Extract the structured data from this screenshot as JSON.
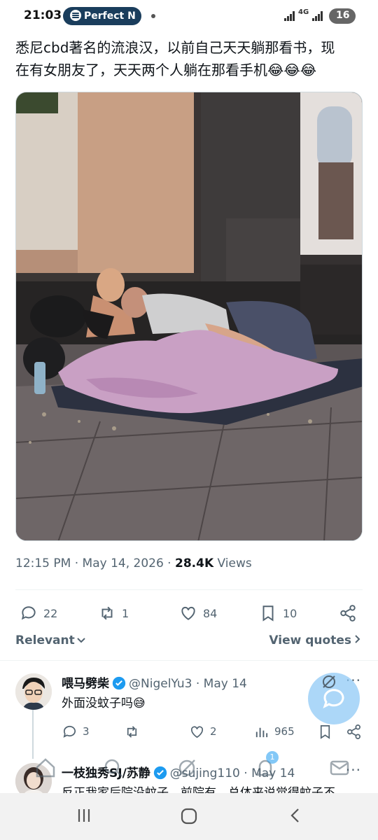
{
  "status_bar": {
    "time": "21:03",
    "app_pill": "Perfect N",
    "network": "4G",
    "battery": "16"
  },
  "tweet": {
    "text_line1": "悉尼cbd著名的流浪汉，以前自己天天躺那看书，现",
    "text_line2": "在有女朋友了，天天两个人躺在那看手机😂😂😂",
    "timestamp": "12:15 PM · May 14, 2026 · ",
    "views_count": "28.4K",
    "views_label": " Views",
    "replies": "22",
    "reposts": "1",
    "likes": "84",
    "bookmarks": "10"
  },
  "sort": {
    "relevant_label": "Relevant",
    "view_quotes_label": "View quotes"
  },
  "replies": [
    {
      "name": "喂马劈柴",
      "handle": "@NigelYu3 · May 14",
      "text": "外面没蚊子吗😅",
      "reply_count": "3",
      "like_count": "2",
      "view_count": "965"
    },
    {
      "name": "一枝独秀SJ/苏静",
      "handle": "@sujing110 · May 14",
      "text": "反正我家后院没蚊子，前院有，总体来说觉得蚊子不"
    }
  ],
  "bottom_nav": {
    "notification_badge": "1"
  },
  "colors": {
    "accent": "#1d9bf0",
    "text_primary": "#0f1419",
    "text_secondary": "#536471",
    "divider": "#eff3f4",
    "blanket": "#c9a0c4"
  },
  "icons": [
    "reply-icon",
    "repost-icon",
    "like-icon",
    "bookmark-icon",
    "share-icon",
    "grok-icon",
    "more-icon",
    "views-icon",
    "verified-badge-icon",
    "compose-icon"
  ]
}
